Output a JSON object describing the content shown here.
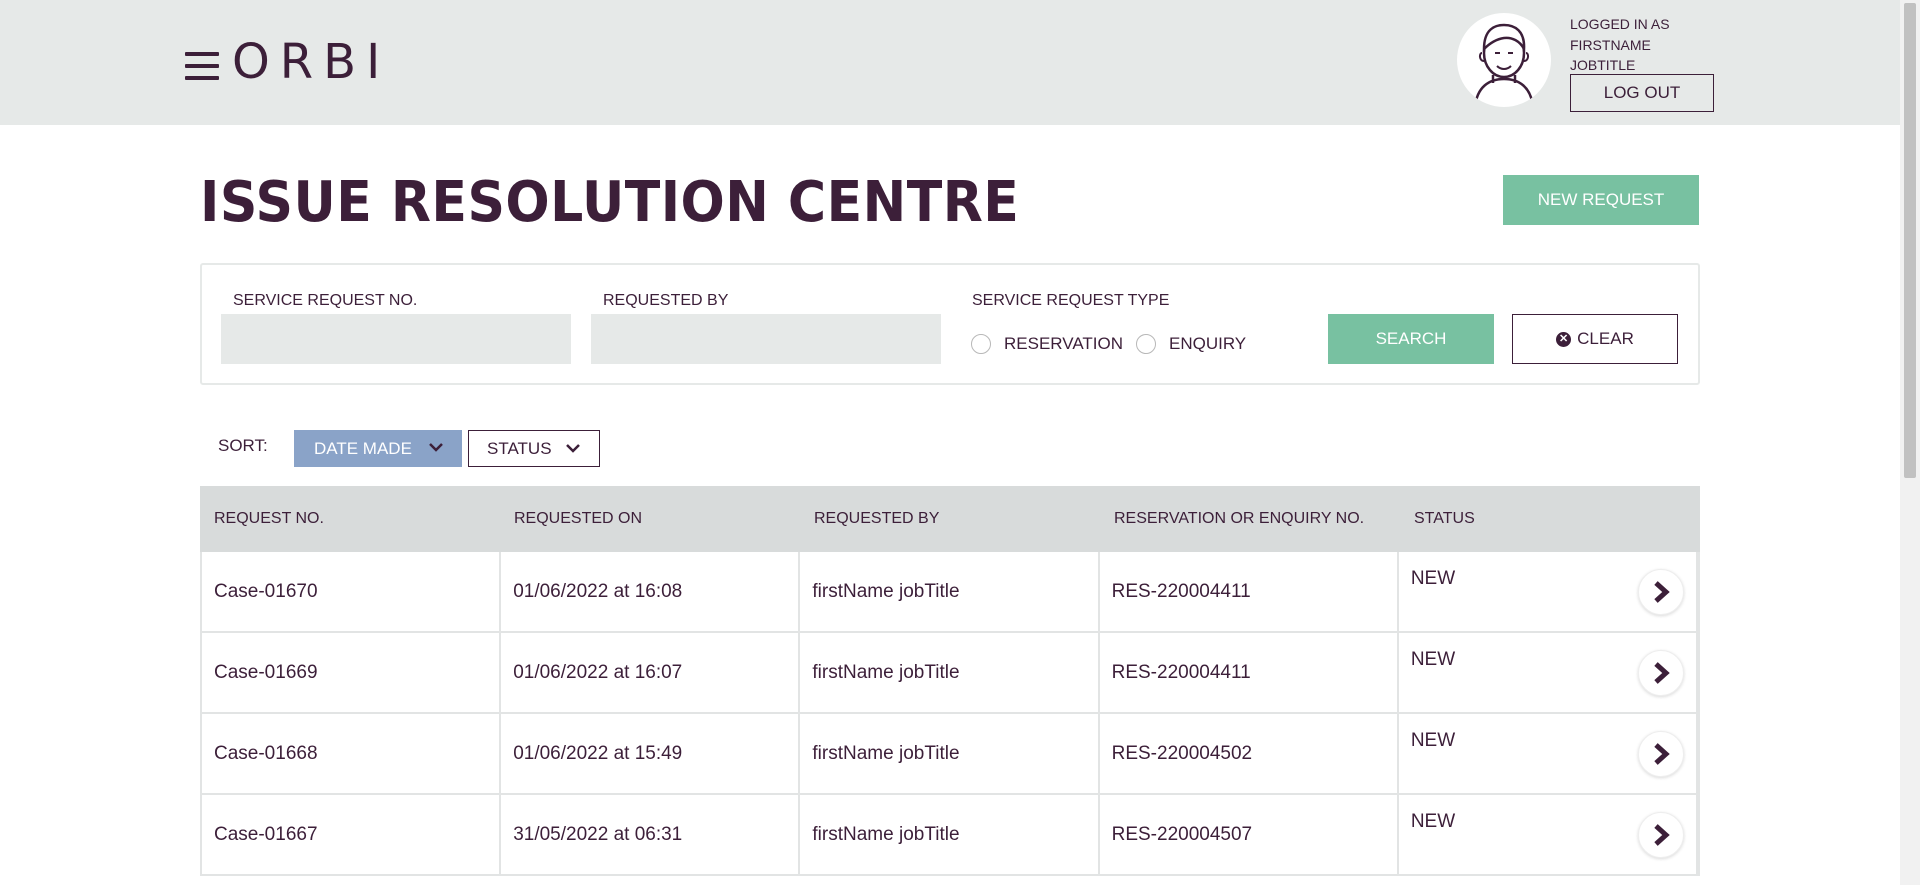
{
  "header": {
    "logo_text": "ORBI",
    "user": {
      "line1": "LOGGED IN AS",
      "line2": "FIRSTNAME",
      "line3": "JOBTITLE"
    },
    "logout_label": "LOG OUT"
  },
  "page": {
    "title": "ISSUE RESOLUTION CENTRE",
    "new_request_label": "NEW REQUEST"
  },
  "filters": {
    "request_no_label": "SERVICE REQUEST NO.",
    "request_no_value": "",
    "requested_by_label": "REQUESTED BY",
    "requested_by_value": "",
    "type_label": "SERVICE REQUEST TYPE",
    "type_options": [
      "RESERVATION",
      "ENQUIRY"
    ],
    "search_label": "SEARCH",
    "clear_label": "CLEAR"
  },
  "sort": {
    "label": "SORT:",
    "options": [
      "DATE MADE",
      "STATUS"
    ]
  },
  "table": {
    "headers": [
      "REQUEST NO.",
      "REQUESTED ON",
      "REQUESTED BY",
      "RESERVATION OR ENQUIRY NO.",
      "STATUS"
    ],
    "rows": [
      [
        "Case-01670",
        "01/06/2022 at 16:08",
        "firstName jobTitle",
        "RES-220004411",
        "NEW"
      ],
      [
        "Case-01669",
        "01/06/2022 at 16:07",
        "firstName jobTitle",
        "RES-220004411",
        "NEW"
      ],
      [
        "Case-01668",
        "01/06/2022 at 15:49",
        "firstName jobTitle",
        "RES-220004502",
        "NEW"
      ],
      [
        "Case-01667",
        "31/05/2022 at 06:31",
        "firstName jobTitle",
        "RES-220004507",
        "NEW"
      ]
    ]
  },
  "colors": {
    "brand": "#3c1f39",
    "accent_green": "#78c1a1",
    "sort_active": "#8aa3c8",
    "header_bg": "#e6e9e8"
  }
}
